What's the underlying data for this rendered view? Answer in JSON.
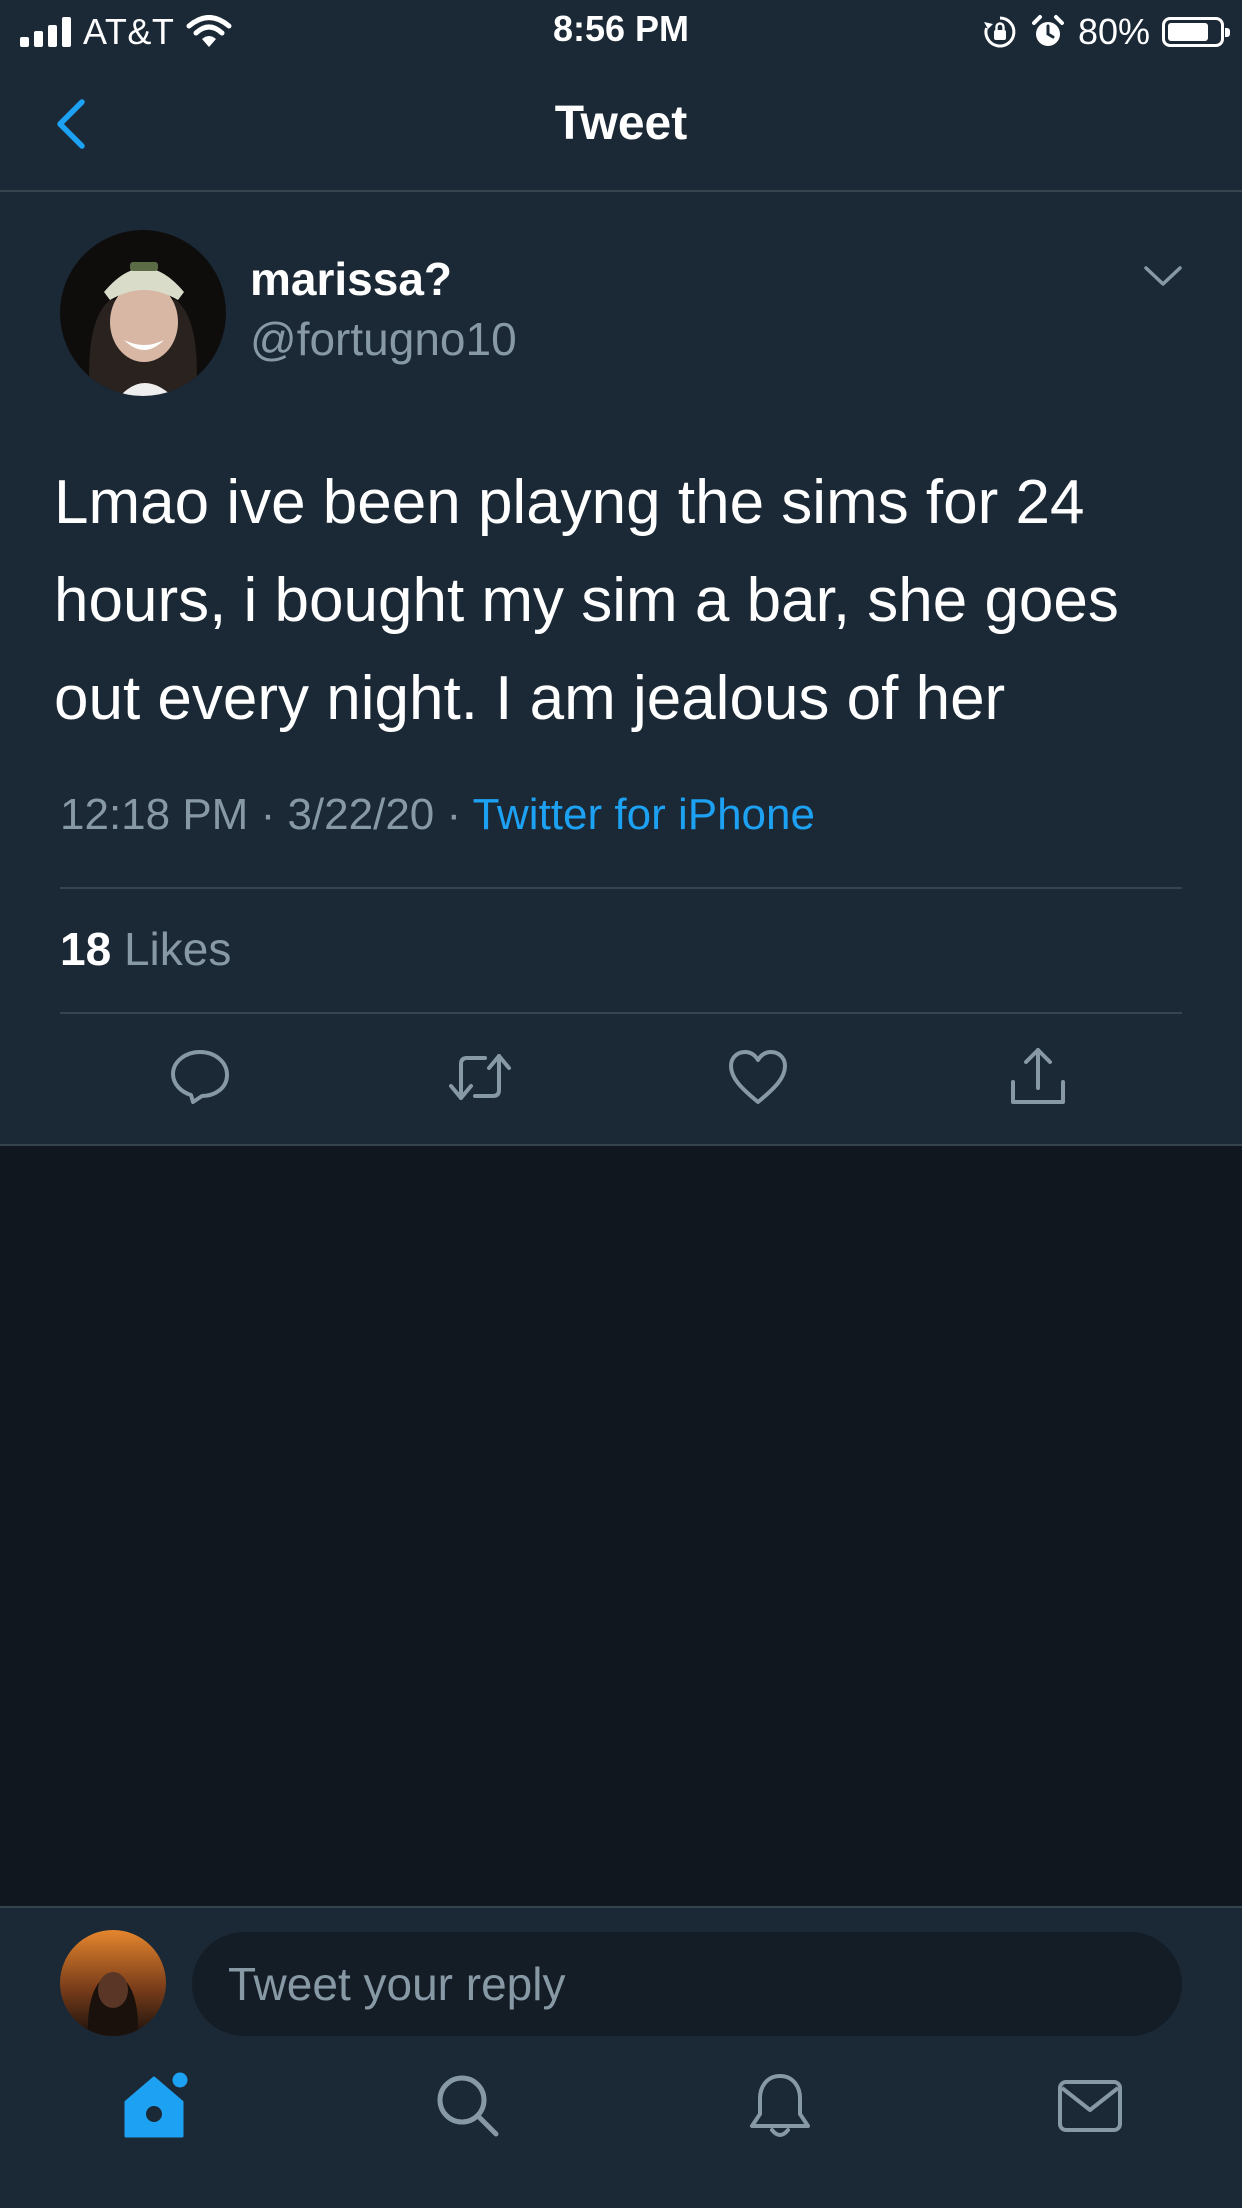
{
  "status_bar": {
    "carrier": "AT&T",
    "time": "8:56 PM",
    "battery_percent": "80%",
    "battery_level": 0.8
  },
  "nav": {
    "title": "Tweet",
    "back_icon": "chevron-left-icon"
  },
  "tweet": {
    "display_name": "marissa?",
    "handle": "@fortugno10",
    "text": "Lmao ive been playng the sims for 24 hours, i bought my sim a bar, she goes out every night. I am jealous of her",
    "time": "12:18 PM",
    "date": "3/22/20",
    "separator": " · ",
    "source": "Twitter for iPhone",
    "likes_count": "18",
    "likes_label": "Likes",
    "actions": [
      "reply-icon",
      "retweet-icon",
      "like-icon",
      "share-icon"
    ]
  },
  "reply": {
    "placeholder": "Tweet your reply"
  },
  "tab_bar": {
    "tabs": [
      "home-icon",
      "search-icon",
      "notifications-icon",
      "messages-icon"
    ],
    "active_tab": "home-icon"
  },
  "colors": {
    "background": "#141d26",
    "surface": "#1b2836",
    "accent": "#1da1f2",
    "secondary_text": "#8899a6",
    "divider": "#38444d"
  }
}
